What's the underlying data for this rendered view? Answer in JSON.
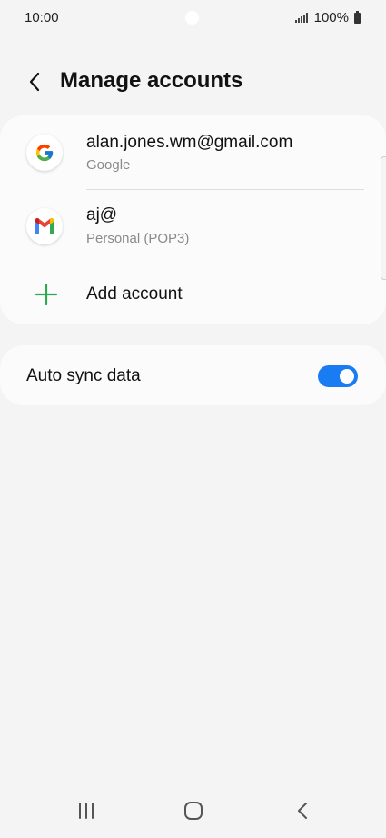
{
  "status_bar": {
    "time": "10:00",
    "battery": "100%"
  },
  "header": {
    "title": "Manage accounts"
  },
  "accounts": [
    {
      "title": "alan.jones.wm@gmail.com",
      "subtitle": "Google",
      "icon": "google-icon"
    },
    {
      "title": "aj@",
      "subtitle": "Personal (POP3)",
      "icon": "gmail-icon"
    }
  ],
  "add_account": {
    "label": "Add account",
    "icon": "plus-icon"
  },
  "auto_sync": {
    "label": "Auto sync data",
    "enabled": true
  },
  "colors": {
    "accent": "#1a7cf2",
    "add_green": "#2fa84f",
    "background": "#f4f4f4",
    "card": "#fbfbfb"
  },
  "nav": {
    "recents_icon": "recents-icon",
    "home_icon": "home-icon",
    "back_icon": "back-icon"
  }
}
